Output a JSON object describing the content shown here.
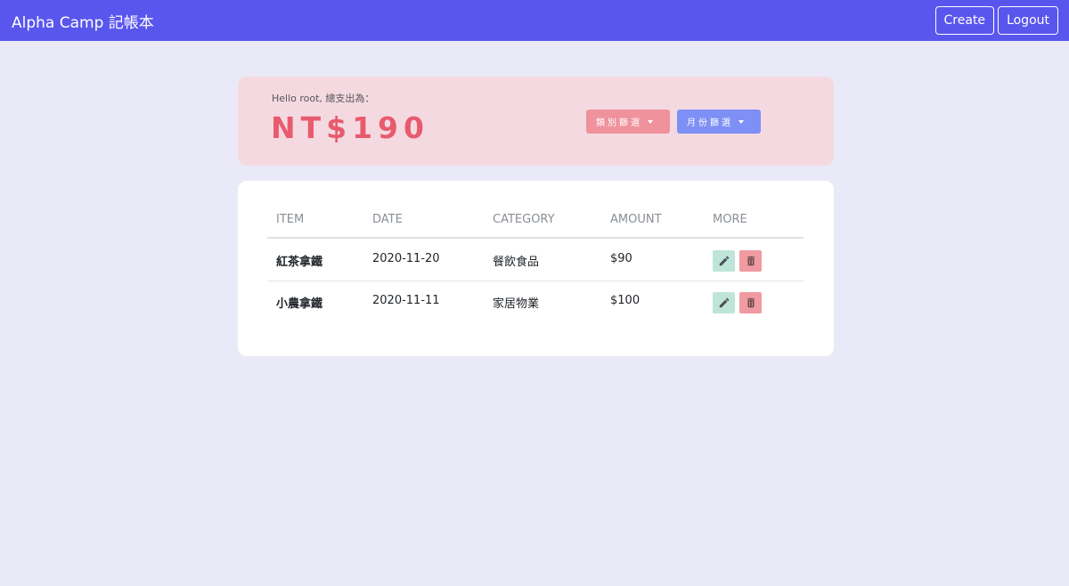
{
  "navbar": {
    "brand": "Alpha Camp 記帳本",
    "create_label": "Create",
    "logout_label": "Logout"
  },
  "summary": {
    "greeting": "Hello root, 總支出為：",
    "total": "NT$190",
    "category_filter_label": "類別篩選",
    "month_filter_label": "月份篩選"
  },
  "table": {
    "headers": [
      "ITEM",
      "DATE",
      "CATEGORY",
      "AMOUNT",
      "MORE"
    ],
    "rows": [
      {
        "item": "紅茶拿鐵",
        "date": "2020-11-20",
        "category": "餐飲食品",
        "amount": "$90"
      },
      {
        "item": "小農拿鐵",
        "date": "2020-11-11",
        "category": "家居物業",
        "amount": "$100"
      }
    ]
  },
  "icons": {
    "edit": "pencil-icon",
    "delete": "trash-icon"
  },
  "colors": {
    "navbar": "#5956ee",
    "background": "#eae9f7",
    "summary_card": "#f5d9e1",
    "total_text": "#e85b6e",
    "category_filter": "#ef929c",
    "month_filter": "#7e8ff5",
    "edit_button": "#bfe5d8",
    "delete_button": "#f09aa1"
  }
}
